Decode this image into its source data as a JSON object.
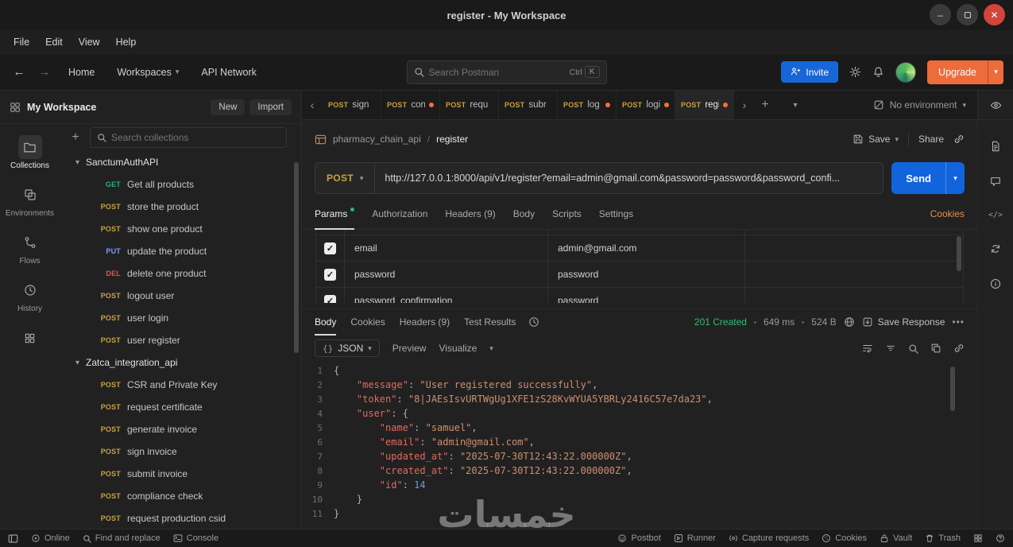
{
  "titlebar": {
    "title": "register - My Workspace"
  },
  "menubar": {
    "items": [
      "File",
      "Edit",
      "View",
      "Help"
    ]
  },
  "navbar": {
    "home": "Home",
    "workspaces": "Workspaces",
    "api_network": "API Network",
    "search_placeholder": "Search Postman",
    "search_shortcut_mod": "Ctrl",
    "search_shortcut_key": "K",
    "invite_label": "Invite",
    "upgrade_label": "Upgrade"
  },
  "workspace_header": {
    "name": "My Workspace",
    "new_label": "New",
    "import_label": "Import",
    "search_placeholder": "Search collections"
  },
  "rail": {
    "items": [
      "Collections",
      "Environments",
      "Flows",
      "History"
    ]
  },
  "tree": [
    {
      "kind": "folder",
      "label": "SanctumAuthAPI"
    },
    {
      "kind": "req",
      "method": "GET",
      "label": "Get all products"
    },
    {
      "kind": "req",
      "method": "POST",
      "label": "store the product"
    },
    {
      "kind": "req",
      "method": "POST",
      "label": "show one product"
    },
    {
      "kind": "req",
      "method": "PUT",
      "label": "update the product"
    },
    {
      "kind": "req",
      "method": "DEL",
      "label": "delete one product"
    },
    {
      "kind": "req",
      "method": "POST",
      "label": "logout user"
    },
    {
      "kind": "req",
      "method": "POST",
      "label": "user login"
    },
    {
      "kind": "req",
      "method": "POST",
      "label": "user register"
    },
    {
      "kind": "folder",
      "label": "Zatca_integration_api"
    },
    {
      "kind": "req",
      "method": "POST",
      "label": "CSR and Private Key"
    },
    {
      "kind": "req",
      "method": "POST",
      "label": "request certificate"
    },
    {
      "kind": "req",
      "method": "POST",
      "label": "generate invoice"
    },
    {
      "kind": "req",
      "method": "POST",
      "label": "sign invoice"
    },
    {
      "kind": "req",
      "method": "POST",
      "label": "submit invoice"
    },
    {
      "kind": "req",
      "method": "POST",
      "label": "compliance check"
    },
    {
      "kind": "req",
      "method": "POST",
      "label": "request production csid"
    }
  ],
  "tabstrip": {
    "tabs": [
      {
        "method": "POST",
        "label": "sign",
        "dirty": false,
        "active": false
      },
      {
        "method": "POST",
        "label": "con",
        "dirty": true,
        "active": false
      },
      {
        "method": "POST",
        "label": "requ",
        "dirty": false,
        "active": false
      },
      {
        "method": "POST",
        "label": "subr",
        "dirty": false,
        "active": false
      },
      {
        "method": "POST",
        "label": "log",
        "dirty": true,
        "active": false
      },
      {
        "method": "POST",
        "label": "logi",
        "dirty": true,
        "active": false
      },
      {
        "method": "POST",
        "label": "regi",
        "dirty": true,
        "active": true
      }
    ],
    "environment": "No environment"
  },
  "request": {
    "breadcrumb_root": "pharmacy_chain_api",
    "breadcrumb_sep": "/",
    "breadcrumb_current": "register",
    "save_label": "Save",
    "share_label": "Share",
    "method": "POST",
    "url": "http://127.0.0.1:8000/api/v1/register?email=admin@gmail.com&password=password&password_confi...",
    "send_label": "Send",
    "tabs": [
      {
        "label": "Params",
        "active": true,
        "dot": true
      },
      {
        "label": "Authorization",
        "active": false,
        "dot": false
      },
      {
        "label": "Headers (9)",
        "active": false,
        "dot": false
      },
      {
        "label": "Body",
        "active": false,
        "dot": false
      },
      {
        "label": "Scripts",
        "active": false,
        "dot": false
      },
      {
        "label": "Settings",
        "active": false,
        "dot": false
      }
    ],
    "cookies_link": "Cookies",
    "params": [
      {
        "key": "email",
        "value": "admin@gmail.com",
        "description": "",
        "checked": true
      },
      {
        "key": "password",
        "value": "password",
        "description": "",
        "checked": true
      },
      {
        "key": "password_confirmation",
        "value": "password",
        "description": "",
        "checked": true
      }
    ]
  },
  "response": {
    "tabs": [
      {
        "label": "Body",
        "active": true
      },
      {
        "label": "Cookies",
        "active": false
      },
      {
        "label": "Headers (9)",
        "active": false
      },
      {
        "label": "Test Results",
        "active": false
      }
    ],
    "status": "201 Created",
    "time": "649 ms",
    "size": "524 B",
    "save_response_label": "Save Response",
    "format_label": "JSON",
    "preview_label": "Preview",
    "visualize_label": "Visualize",
    "code_lines": [
      {
        "n": "1",
        "t": [
          [
            "pun",
            "{"
          ]
        ]
      },
      {
        "n": "2",
        "t": [
          [
            "pun",
            "    "
          ],
          [
            "key",
            "\"message\""
          ],
          [
            "pun",
            ": "
          ],
          [
            "str",
            "\"User registered successfully\""
          ],
          [
            "pun",
            ","
          ]
        ]
      },
      {
        "n": "3",
        "t": [
          [
            "pun",
            "    "
          ],
          [
            "key",
            "\"token\""
          ],
          [
            "pun",
            ": "
          ],
          [
            "str",
            "\"8|JAEsIsvURTWgUg1XFE1zS28KvWYUA5YBRLy2416C57e7da23\""
          ],
          [
            "pun",
            ","
          ]
        ]
      },
      {
        "n": "4",
        "t": [
          [
            "pun",
            "    "
          ],
          [
            "key",
            "\"user\""
          ],
          [
            "pun",
            ": {"
          ]
        ]
      },
      {
        "n": "5",
        "t": [
          [
            "pun",
            "        "
          ],
          [
            "key",
            "\"name\""
          ],
          [
            "pun",
            ": "
          ],
          [
            "str",
            "\"samuel\""
          ],
          [
            "pun",
            ","
          ]
        ]
      },
      {
        "n": "6",
        "t": [
          [
            "pun",
            "        "
          ],
          [
            "key",
            "\"email\""
          ],
          [
            "pun",
            ": "
          ],
          [
            "str",
            "\"admin@gmail.com\""
          ],
          [
            "pun",
            ","
          ]
        ]
      },
      {
        "n": "7",
        "t": [
          [
            "pun",
            "        "
          ],
          [
            "key",
            "\"updated_at\""
          ],
          [
            "pun",
            ": "
          ],
          [
            "str",
            "\"2025-07-30T12:43:22.000000Z\""
          ],
          [
            "pun",
            ","
          ]
        ]
      },
      {
        "n": "8",
        "t": [
          [
            "pun",
            "        "
          ],
          [
            "key",
            "\"created_at\""
          ],
          [
            "pun",
            ": "
          ],
          [
            "str",
            "\"2025-07-30T12:43:22.000000Z\""
          ],
          [
            "pun",
            ","
          ]
        ]
      },
      {
        "n": "9",
        "t": [
          [
            "pun",
            "        "
          ],
          [
            "key",
            "\"id\""
          ],
          [
            "pun",
            ": "
          ],
          [
            "num",
            "14"
          ]
        ]
      },
      {
        "n": "10",
        "t": [
          [
            "pun",
            "    }"
          ]
        ]
      },
      {
        "n": "11",
        "t": [
          [
            "pun",
            "}"
          ]
        ]
      }
    ]
  },
  "statusbar": {
    "online": "Online",
    "find": "Find and replace",
    "console": "Console",
    "postbot": "Postbot",
    "runner": "Runner",
    "capture": "Capture requests",
    "cookies": "Cookies",
    "vault": "Vault",
    "trash": "Trash"
  },
  "watermark": "خمسات",
  "colors": {
    "accent_orange": "#ff6c37",
    "send_blue": "#1264dd",
    "status_green": "#2fbf71",
    "method_get": "#2eaf73",
    "method_post": "#c9a23f",
    "method_put": "#7f9cf5",
    "method_del": "#e3564d"
  }
}
